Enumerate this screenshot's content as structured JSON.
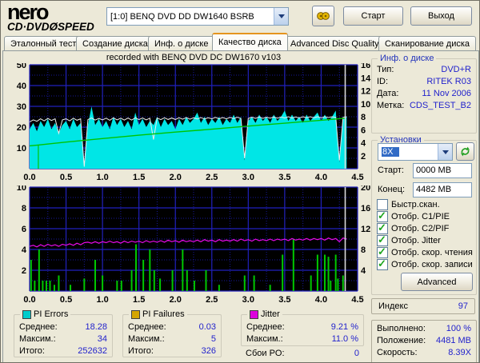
{
  "colors": {
    "window_bg": "#ECE9D8",
    "accent_tab": "#E5941E",
    "value_blue": "#2222CC",
    "chart_bg": "#000000",
    "grid_major": "#2121BD",
    "grid_minor": "#18189B",
    "pie_cyan": "#00E6E6",
    "pif_green": "#00C800",
    "jitter_magenta": "#E80AE8",
    "read_white": "#EFEFEF",
    "end_line": "#D9D9D9",
    "legend_pi_errors": "#00CCCC",
    "legend_pi_failures": "#D5A500",
    "legend_jitter": "#DD00DD"
  },
  "toolbar": {
    "logo_line1": "nero",
    "logo_line2": "CD·DVDØSPEED",
    "device_value": "[1:0]   BENQ DVD DD DW1640 BSRB",
    "tool_icon": "disc-info-icon",
    "start_label": "Старт",
    "exit_label": "Выход"
  },
  "tabs": [
    {
      "label": "Эталонный тест"
    },
    {
      "label": "Создание диска"
    },
    {
      "label": "Инф. о диске"
    },
    {
      "label": "Качество диска"
    },
    {
      "label": "Advanced Disc Quality"
    },
    {
      "label": "Сканирование диска"
    }
  ],
  "active_tab_index": 3,
  "chart_header": "recorded with BENQ    DVD DC DW1670    v103",
  "chart_data": [
    {
      "type": "area",
      "title": "recorded with BENQ    DVD DC DW1670    v103",
      "xlim": [
        0,
        4.5
      ],
      "ylim_left": [
        0,
        50
      ],
      "ylim_right": [
        0,
        16
      ],
      "x_ticks": [
        "0.0",
        "0.5",
        "1.0",
        "1.5",
        "2.0",
        "2.5",
        "3.0",
        "3.5",
        "4.0",
        "4.5"
      ],
      "left_ticks": [
        50,
        40,
        30,
        20,
        10
      ],
      "right_ticks": [
        16,
        14,
        12,
        10,
        8,
        6,
        4,
        2
      ],
      "grid": {
        "x_major": 0.5,
        "x_minor": 0.25,
        "y_major": 10,
        "y_minor": 5,
        "on": true
      },
      "legend_position": "none",
      "end_line_x": 4.33,
      "series": [
        {
          "name": "PI Errors",
          "type": "area",
          "axis": "left",
          "color": "#00E6E6",
          "x_step": 0.05,
          "values": [
            19,
            22,
            18,
            23,
            20,
            24,
            19,
            22,
            17,
            21,
            23,
            19,
            24,
            20,
            22,
            2,
            21,
            30,
            21,
            24,
            20,
            23,
            19,
            25,
            21,
            24,
            20,
            23,
            19,
            27,
            21,
            24,
            20,
            23,
            21,
            25,
            20,
            24,
            21,
            23,
            19,
            24,
            21,
            25,
            22,
            24,
            27,
            22,
            25,
            21,
            24,
            22,
            25,
            21,
            24,
            22,
            26,
            22,
            25,
            4,
            23,
            25,
            22,
            26,
            23,
            25,
            22,
            26,
            23,
            25,
            28,
            23,
            26,
            23,
            25,
            22,
            26,
            23,
            25,
            27,
            23,
            26,
            23,
            25,
            28,
            3,
            24,
            25
          ]
        },
        {
          "name": "Reading speed",
          "type": "line",
          "axis": "left",
          "color": "#EFEFEF",
          "width": 1,
          "x_step": 0.05,
          "values": [
            22.5,
            23.5,
            22.8,
            24,
            23,
            24.2,
            23.2,
            24,
            17,
            23.5,
            24,
            23,
            24.3,
            23.3,
            24,
            1,
            23.6,
            24.4,
            23.4,
            24.2,
            23.5,
            24.3,
            23.3,
            24.5,
            23.5,
            24.3,
            23.4,
            24.4,
            23.4,
            24.5,
            23.6,
            24.4,
            23.5,
            24.3,
            14,
            24.4,
            23.6,
            24.5,
            23.7,
            24.4,
            23.7,
            24.5,
            23.8,
            24.6,
            23.8,
            24.5,
            23.9,
            24.6,
            23.9,
            24.5,
            24,
            24.7,
            24,
            24.6,
            24,
            24.7,
            24.1,
            24.8,
            24.1,
            5,
            24.2,
            24.8,
            24.2,
            24.9,
            24.2,
            24.8,
            24.3,
            24.9,
            24.3,
            24.9,
            24.4,
            25,
            24.4,
            24.9,
            24.4,
            25,
            24.5,
            25,
            24.5,
            25,
            24.5,
            25,
            24.6,
            25,
            24.6,
            4,
            24.7,
            25
          ]
        },
        {
          "name": "Writing speed",
          "type": "line",
          "axis": "left",
          "color": "#00C400",
          "width": 1.4,
          "points": [
            [
              0,
              11
            ],
            [
              0.1,
              11.3
            ],
            [
              0.5,
              12.8
            ],
            [
              1.0,
              14.5
            ],
            [
              1.5,
              16.1
            ],
            [
              2.0,
              17.6
            ],
            [
              2.5,
              19.0
            ],
            [
              3.0,
              20.5
            ],
            [
              3.5,
              21.9
            ],
            [
              4.0,
              23.3
            ],
            [
              4.33,
              24.3
            ]
          ],
          "drops": [
            [
              0.12,
              11.35
            ]
          ]
        }
      ]
    },
    {
      "type": "bar",
      "title": "",
      "xlim": [
        0,
        4.5
      ],
      "ylim_left": [
        0,
        10
      ],
      "ylim_right": [
        0,
        20
      ],
      "x_ticks": [
        "0.0",
        "0.5",
        "1.0",
        "1.5",
        "2.0",
        "2.5",
        "3.0",
        "3.5",
        "4.0",
        "4.5"
      ],
      "left_ticks": [
        10,
        8,
        6,
        4,
        2
      ],
      "right_ticks": [
        20,
        16,
        12,
        8,
        4
      ],
      "grid": {
        "x_major": 0.5,
        "x_minor": 0.25,
        "y_major": 2,
        "y_minor": 1,
        "on": true
      },
      "legend_position": "none",
      "end_line_x": 4.33,
      "series": [
        {
          "name": "PI Failures",
          "type": "bars",
          "axis": "left",
          "color": "#00C800",
          "points": [
            [
              0.02,
              3
            ],
            [
              0.07,
              1
            ],
            [
              0.13,
              4
            ],
            [
              0.18,
              1
            ],
            [
              0.23,
              1
            ],
            [
              0.28,
              1
            ],
            [
              0.34,
              0.6
            ],
            [
              0.4,
              1.5
            ],
            [
              0.56,
              0.6
            ],
            [
              0.75,
              1.2
            ],
            [
              0.9,
              3
            ],
            [
              1.0,
              1.5
            ],
            [
              1.2,
              1
            ],
            [
              1.26,
              1
            ],
            [
              1.4,
              2
            ],
            [
              1.46,
              4.5
            ],
            [
              1.56,
              3
            ],
            [
              1.65,
              4
            ],
            [
              1.71,
              2
            ],
            [
              1.79,
              1.2
            ],
            [
              1.96,
              2
            ],
            [
              2.1,
              4
            ],
            [
              2.16,
              2
            ],
            [
              2.26,
              1
            ],
            [
              2.42,
              2
            ],
            [
              2.6,
              0.6
            ],
            [
              2.95,
              1.5
            ],
            [
              3.08,
              1.5
            ],
            [
              3.3,
              0.6
            ],
            [
              3.47,
              3.5
            ],
            [
              3.62,
              5
            ],
            [
              3.86,
              1.5
            ],
            [
              3.95,
              3.5
            ],
            [
              4.05,
              3.5
            ],
            [
              4.1,
              3.3
            ],
            [
              4.13,
              1
            ],
            [
              4.2,
              3.5
            ],
            [
              4.23,
              1.2
            ],
            [
              4.3,
              1.5
            ]
          ]
        },
        {
          "name": "Jitter",
          "type": "line",
          "axis": "right",
          "color": "#E80AE8",
          "width": 1.2,
          "x_step": 0.05,
          "values": [
            8.6,
            8.8,
            8.5,
            8.9,
            8.6,
            9.0,
            8.7,
            8.9,
            8.6,
            9.0,
            8.8,
            9.1,
            8.8,
            9.2,
            8.9,
            9.3,
            9.4,
            9.2,
            9.5,
            9.2,
            9.5,
            9.3,
            9.6,
            9.3,
            9.5,
            9.2,
            9.6,
            9.3,
            9.6,
            9.4,
            9.6,
            9.3,
            9.7,
            9.4,
            9.6,
            9.4,
            9.7,
            9.4,
            9.8,
            9.5,
            9.7,
            9.4,
            9.8,
            9.5,
            9.7,
            9.5,
            9.8,
            9.5,
            9.9,
            9.6,
            9.8,
            9.5,
            9.9,
            9.6,
            9.8,
            9.6,
            9.9,
            9.6,
            10.0,
            9.7,
            9.9,
            9.6,
            10.0,
            9.7,
            9.9,
            9.7,
            10.0,
            9.7,
            10.0,
            9.8,
            10.0,
            9.7,
            10.1,
            9.8,
            10.0,
            9.8,
            10.1,
            9.8,
            10.1,
            9.9,
            10.1,
            9.8,
            10.2,
            9.9,
            10.1,
            9.5,
            10.2,
            10.0
          ]
        }
      ]
    }
  ],
  "disc_info": {
    "legend": "Инф. о диске",
    "rows": [
      [
        "Тип:",
        "DVD+R"
      ],
      [
        "ID:",
        "RITEK R03"
      ],
      [
        "Дата:",
        "11 Nov 2006"
      ],
      [
        "Метка:",
        "CDS_TEST_B2"
      ]
    ]
  },
  "settings": {
    "legend": "Установки",
    "speed_value": "8X",
    "refresh_icon": "refresh-icon",
    "start_label": "Старт:",
    "start_value": "0000 MB",
    "end_label": "Конец:",
    "end_value": "4482 MB",
    "checkboxes": [
      {
        "label": "Быстр.скан.",
        "checked": false
      },
      {
        "label": "Отобр. C1/PIE",
        "checked": true
      },
      {
        "label": "Отобр. C2/PIF",
        "checked": true
      },
      {
        "label": "Отобр. Jitter",
        "checked": true
      },
      {
        "label": "Отобр. скор. чтения",
        "checked": true
      },
      {
        "label": "Отобр. скор. записи",
        "checked": true
      }
    ],
    "advanced_label": "Advanced"
  },
  "index_panel": {
    "label": "Индекс",
    "value": "97"
  },
  "progress_panel": {
    "rows": [
      [
        "Выполнено:",
        "100 %"
      ],
      [
        "Положение:",
        "4481 MB"
      ],
      [
        "Скорость:",
        "8.39X"
      ]
    ]
  },
  "stats": {
    "pi_errors": {
      "legend": "PI Errors",
      "color": "#00CCCC",
      "rows": [
        [
          "Среднее:",
          "18.28"
        ],
        [
          "Максим.:",
          "34"
        ],
        [
          "Итого:",
          "252632"
        ]
      ]
    },
    "pi_failures": {
      "legend": "PI Failures",
      "color": "#D5A500",
      "rows": [
        [
          "Среднее:",
          "0.03"
        ],
        [
          "Максим.:",
          "5"
        ],
        [
          "Итого:",
          "326"
        ]
      ]
    },
    "jitter": {
      "legend": "Jitter",
      "color": "#DD00DD",
      "rows": [
        [
          "Среднее:",
          "9.21 %"
        ],
        [
          "Максим.:",
          "11.0 %"
        ]
      ]
    },
    "po_failures": {
      "label": "Сбои PO:",
      "value": "0"
    }
  }
}
